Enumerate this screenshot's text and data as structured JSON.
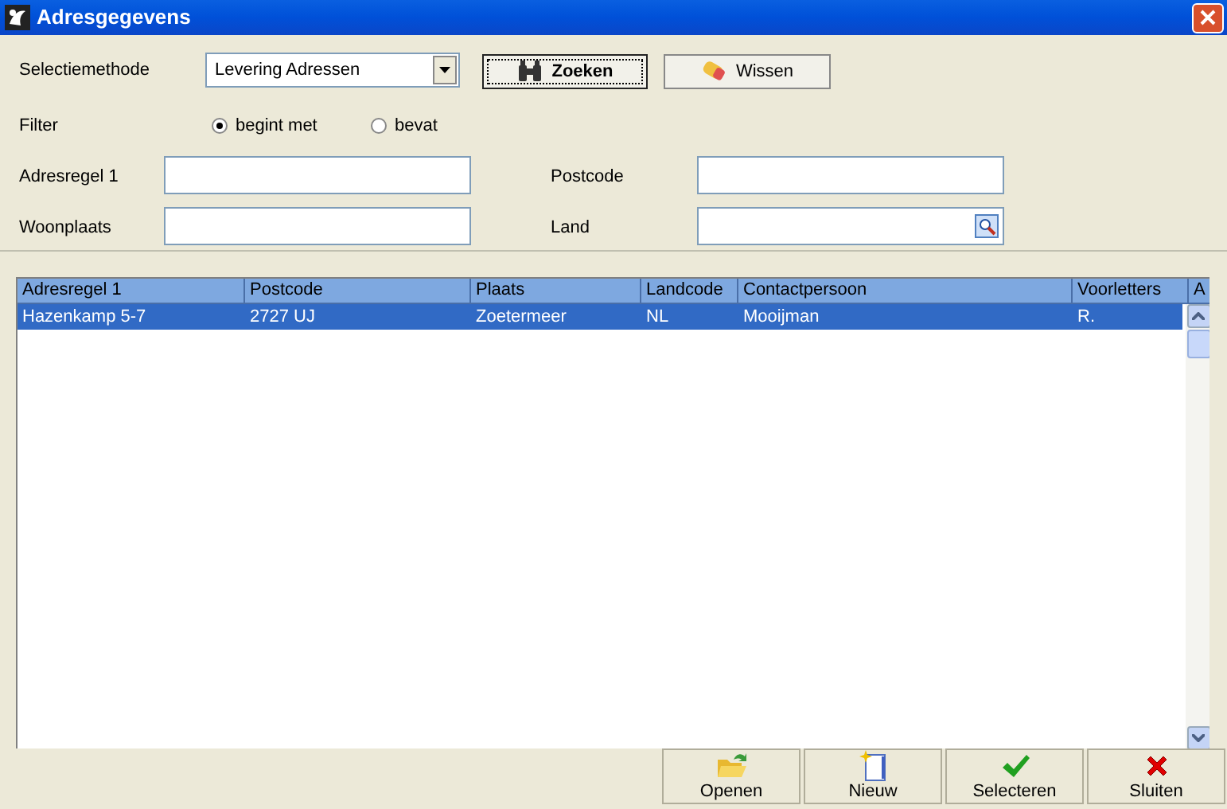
{
  "window": {
    "title": "Adresgegevens"
  },
  "selection": {
    "label": "Selectiemethode",
    "value": "Levering Adressen"
  },
  "top_buttons": [
    {
      "label": "Zoeken",
      "kind": "search",
      "default": true
    },
    {
      "label": "Wissen",
      "kind": "eraser",
      "default": false
    }
  ],
  "filter": {
    "label": "Filter",
    "options": [
      {
        "label": "begint met",
        "selected": true
      },
      {
        "label": "bevat",
        "selected": false
      }
    ]
  },
  "fields": [
    {
      "label": "Adresregel 1",
      "lookup": false
    },
    {
      "label": "Postcode",
      "lookup": false
    },
    {
      "label": "Woonplaats",
      "lookup": false
    },
    {
      "label": "Land",
      "lookup": true
    }
  ],
  "table": {
    "columns": [
      "Adresregel 1",
      "Postcode",
      "Plaats",
      "Landcode",
      "Contactpersoon",
      "Voorletters",
      "A"
    ],
    "rows": [
      {
        "cells": [
          "Hazenkamp 5-7",
          "2727 UJ",
          "Zoetermeer",
          "NL",
          "Mooijman",
          "R."
        ],
        "selected": true
      }
    ]
  },
  "bottom_buttons": [
    {
      "label": "Openen",
      "kind": "open"
    },
    {
      "label": "Nieuw",
      "kind": "new"
    },
    {
      "label": "Selecteren",
      "kind": "select"
    },
    {
      "label": "Sluiten",
      "kind": "close"
    }
  ]
}
